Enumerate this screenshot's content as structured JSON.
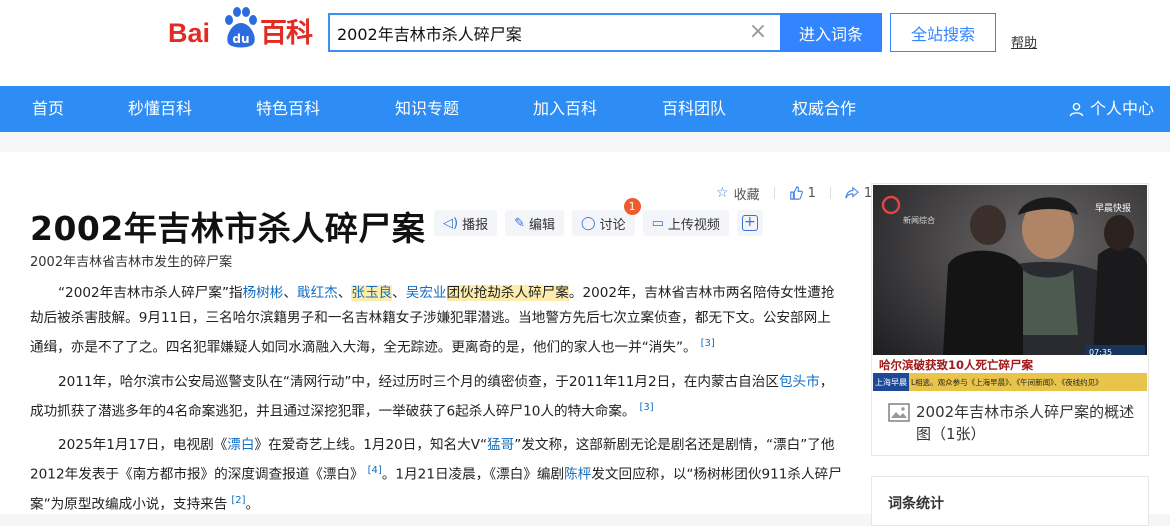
{
  "header": {
    "logo_bai": "Bai",
    "logo_du": "du",
    "logo_baike": "百科",
    "search_value": "2002年吉林市杀人碎尸案",
    "enter_label": "进入词条",
    "site_search_label": "全站搜索",
    "help_label": "帮助"
  },
  "nav": {
    "items": [
      "首页",
      "秒懂百科",
      "特色百科",
      "知识专题",
      "加入百科",
      "百科团队",
      "权威合作"
    ],
    "user_label": "个人中心"
  },
  "actions": {
    "favorite_label": "收藏",
    "like_count": "1",
    "share_count": "1"
  },
  "article": {
    "title": "2002年吉林市杀人碎尸案",
    "tools": {
      "broadcast": "播报",
      "edit": "编辑",
      "discuss": "讨论",
      "discuss_badge": "1",
      "upload_video": "上传视频",
      "add": "+"
    },
    "subtitle": "2002年吉林省吉林市发生的碎尸案",
    "p1": {
      "t1": "“2002年吉林市杀人碎尸案”指",
      "l1": "杨树彬",
      "t2": "、",
      "l2": "戢红杰",
      "t3": "、",
      "l3": "张玉良",
      "t4": "、",
      "l4": "吴宏业",
      "t5": "团伙抢劫杀人碎尸案",
      "t6": "。2002年，吉林省吉林市两名陪侍女性遭抢劫后被杀害肢解。9月11日，三名哈尔滨籍男子和一名吉林籍女子涉嫌犯罪潜逃。当地警方先后七次立案侦查，都无下文。公安部网上通缉，亦是不了了之。四名犯罪嫌疑人如同水滴融入大海，全无踪迹。更离奇的是，他们的家人也一并“消失”。",
      "ref": "[3]"
    },
    "p2": {
      "t1": "2011年，哈尔滨市公安局巡警支队在“清网行动”中，经过历时三个月的缜密侦查，于2011年11月2日，在内蒙古自治区",
      "l1": "包头市",
      "t2": "，成功抓获了潜逃多年的4名命案逃犯，并且通过深挖犯罪，一举破获了6起杀人碎尸10人的特大命案。",
      "ref": "[3]"
    },
    "p3": {
      "t1": "2025年1月17日，电视剧《",
      "l1": "漂白",
      "t2": "》在爱奇艺上线。1月20日，知名大V“",
      "l2": "猛哥",
      "t3": "”发文称，这部新剧无论是剧名还是剧情，“漂白”了他2012年发表于《南方都市报》的深度调查报道《漂白》",
      "ref1": "[4]",
      "t4": "。1月21日凌晨，《漂白》编剧",
      "l3": "陈枰",
      "t5": "发文回应称，以“杨树彬团伙911杀人碎尸案”为原型改编成小说，支持来告",
      "ref2": "[2]",
      "t6": "。"
    }
  },
  "sidebar": {
    "photo_banner_text": "哈尔滨破获致10人死亡碎尸案",
    "photo_ticker": "上海早晨",
    "photo_ticker_text": "L相逃。观众参与《上海早晨》、《午间新闻》、《夜线约见》",
    "photo_channel": "新闻综合",
    "photo_program": "早晨快报",
    "photo_time": "07:35",
    "image_caption": "2002年吉林市杀人碎尸案的概述图（1张）",
    "stats_title": "词条统计"
  },
  "colors": {
    "brand_red": "#e32b23",
    "brand_blue": "#2e8cf5",
    "link_blue": "#136ec2",
    "highlight": "#fcedad"
  }
}
